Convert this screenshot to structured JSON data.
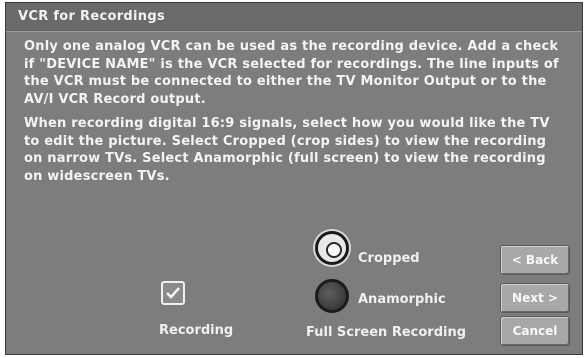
{
  "dialog": {
    "title": "VCR for Recordings",
    "paragraph1": "Only one analog VCR can be used as the recording device. Add a check if \"DEVICE NAME\" is the VCR selected for recordings. The line inputs of the VCR must be connected to either the TV Monitor Output or to the AV/I VCR Record output.",
    "paragraph2": "When recording digital 16:9 signals, select how you would like the TV to edit the picture. Select Cropped (crop sides) to view the recording on narrow TVs. Select Anamorphic (full screen) to view the recording on widescreen TVs."
  },
  "options": {
    "cropped_label": "Cropped",
    "cropped_selected": true,
    "anamorphic_label": "Anamorphic",
    "anamorphic_selected": false,
    "group_caption": "Full Screen Recording"
  },
  "recording": {
    "caption": "Recording",
    "checked": true
  },
  "buttons": {
    "back": "< Back",
    "next": "Next >",
    "cancel": "Cancel"
  },
  "colors": {
    "panel": "#7d7d7d",
    "title_bar": "#6a6a6a",
    "text": "#f4f4f4"
  }
}
